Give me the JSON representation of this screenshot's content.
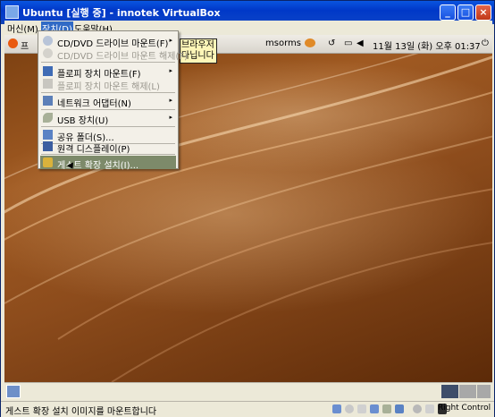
{
  "window": {
    "title": "Ubuntu [실행 중] - innotek VirtualBox",
    "minimize": "_",
    "maximize": "□",
    "close": "×"
  },
  "menubar": {
    "machine": "머신(M)",
    "devices": "장치(D)",
    "help": "도움말(H)"
  },
  "guest_panel": {
    "apps_label": "프",
    "user": "msorms",
    "clock": "11월 13일 (화) 오후 01:37"
  },
  "tooltip": {
    "line1": "브라우저",
    "line2": "다닙니다"
  },
  "devices_menu": {
    "items": [
      {
        "label": "CD/DVD 드라이브 마운트(F)",
        "submenu": "▸"
      },
      {
        "label": "CD/DVD 드라이브 마운트 해제(F)"
      },
      {
        "label": "플로피 장치 마운트(F)",
        "submenu": "▸"
      },
      {
        "label": "플로피 장치 마운트 해제(L)"
      },
      {
        "label": "네트워크 어댑터(N)",
        "submenu": "▸"
      },
      {
        "label": "USB 장치(U)",
        "submenu": "▸"
      },
      {
        "label": "공유 폴더(S)..."
      },
      {
        "label": "원격 디스플레이(P)"
      },
      {
        "label": "게스트 확장 설치(I)..."
      }
    ]
  },
  "statusbar": {
    "message": "게스트 확장 설치 이미지를 마운트합니다",
    "host_key": "Right Control"
  },
  "colors": {
    "titlebar": "#0a55e0",
    "menu_selected": "#7d8a6a",
    "guest_bg": "#8d4c1c"
  }
}
